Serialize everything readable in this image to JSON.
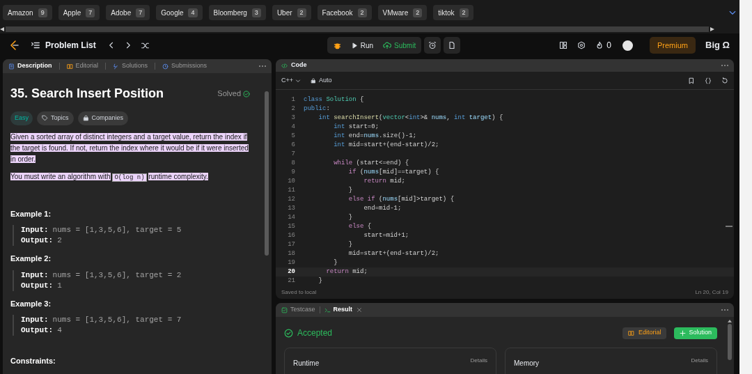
{
  "companies": [
    {
      "name": "Amazon",
      "count": "9"
    },
    {
      "name": "Apple",
      "count": "7"
    },
    {
      "name": "Adobe",
      "count": "7"
    },
    {
      "name": "Google",
      "count": "4"
    },
    {
      "name": "Bloomberg",
      "count": "3"
    },
    {
      "name": "Uber",
      "count": "2"
    },
    {
      "name": "Facebook",
      "count": "2"
    },
    {
      "name": "VMware",
      "count": "2"
    },
    {
      "name": "tiktok",
      "count": "2"
    }
  ],
  "nav": {
    "problem_list": "Problem List",
    "run": "Run",
    "submit": "Submit",
    "streak": "0",
    "premium": "Premium",
    "brand": "Big Ω"
  },
  "description": {
    "tabs": [
      {
        "label": "Description",
        "selected": true
      },
      {
        "label": "Editorial",
        "selected": false
      },
      {
        "label": "Solutions",
        "selected": false
      },
      {
        "label": "Submissions",
        "selected": false
      }
    ],
    "title": "35. Search Insert Position",
    "status": "Solved",
    "difficulty": "Easy",
    "topics": "Topics",
    "companies": "Companies",
    "paragraphs": [
      {
        "highlighted": true,
        "text": "Given a sorted array of distinct integers and a target value, return the index if the target is found. If not, return the index where it would be if it were inserted in order."
      },
      {
        "highlighted": true,
        "text": "You must write an algorithm with",
        "code": "O(log n)",
        "text_after": "runtime complexity."
      }
    ],
    "examples": [
      {
        "title": "Example 1:",
        "input_label": "Input:",
        "input": "nums = [1,3,5,6], target = 5",
        "output_label": "Output:",
        "output": "2"
      },
      {
        "title": "Example 2:",
        "input_label": "Input:",
        "input": "nums = [1,3,5,6], target = 2",
        "output_label": "Output:",
        "output": "1"
      },
      {
        "title": "Example 3:",
        "input_label": "Input:",
        "input": "nums = [1,3,5,6], target = 7",
        "output_label": "Output:",
        "output": "4"
      }
    ],
    "constraints": "Constraints:"
  },
  "code": {
    "title": "Code",
    "language": "C++",
    "mode": "Auto",
    "saved": "Saved to local",
    "cursor": "Ln 20, Col 19",
    "lines": [
      {
        "number": "1",
        "current": false,
        "tokens": [
          {
            "kind": "keyword",
            "text": "class "
          },
          {
            "kind": "type",
            "text": "Solution"
          },
          {
            "kind": "plain",
            "text": " {"
          }
        ]
      },
      {
        "number": "2",
        "current": false,
        "tokens": [
          {
            "kind": "keyword",
            "text": "public"
          },
          {
            "kind": "plain",
            "text": ":"
          }
        ]
      },
      {
        "number": "3",
        "current": false,
        "tokens": [
          {
            "kind": "keyword",
            "text": "    int "
          },
          {
            "kind": "func",
            "text": "searchInsert"
          },
          {
            "kind": "plain",
            "text": "("
          },
          {
            "kind": "type",
            "text": "vector"
          },
          {
            "kind": "plain",
            "text": "<"
          },
          {
            "kind": "keyword",
            "text": "int"
          },
          {
            "kind": "plain",
            "text": ">& "
          },
          {
            "kind": "var",
            "text": "nums"
          },
          {
            "kind": "plain",
            "text": ", "
          },
          {
            "kind": "keyword",
            "text": "int "
          },
          {
            "kind": "var",
            "text": "target"
          },
          {
            "kind": "plain",
            "text": ") {"
          }
        ]
      },
      {
        "number": "4",
        "current": false,
        "tokens": [
          {
            "kind": "keyword",
            "text": "        int"
          },
          {
            "kind": "plain",
            "text": " start=0;"
          }
        ]
      },
      {
        "number": "5",
        "current": false,
        "tokens": [
          {
            "kind": "keyword",
            "text": "        int"
          },
          {
            "kind": "plain",
            "text": " end="
          },
          {
            "kind": "var",
            "text": "nums"
          },
          {
            "kind": "plain",
            "text": ".size()-1;"
          }
        ]
      },
      {
        "number": "6",
        "current": false,
        "tokens": [
          {
            "kind": "keyword",
            "text": "        int"
          },
          {
            "kind": "plain",
            "text": " mid=start+(end-start)/2;"
          }
        ]
      },
      {
        "number": "7",
        "current": false
      },
      {
        "number": "8",
        "current": false,
        "tokens": [
          {
            "kind": "control",
            "text": "        while"
          },
          {
            "kind": "plain",
            "text": " (start<=end) {"
          }
        ]
      },
      {
        "number": "9",
        "current": false,
        "tokens": [
          {
            "kind": "control",
            "text": "            if"
          },
          {
            "kind": "plain",
            "text": " ("
          },
          {
            "kind": "var",
            "text": "nums"
          },
          {
            "kind": "plain",
            "text": "[mid]==target) {"
          }
        ]
      },
      {
        "number": "10",
        "current": false,
        "tokens": [
          {
            "kind": "control",
            "text": "                return"
          },
          {
            "kind": "plain",
            "text": " mid;"
          }
        ]
      },
      {
        "number": "11",
        "current": false,
        "tokens": [
          {
            "kind": "plain",
            "text": "            }"
          }
        ]
      },
      {
        "number": "12",
        "current": false,
        "tokens": [
          {
            "kind": "control",
            "text": "            else if"
          },
          {
            "kind": "plain",
            "text": " ("
          },
          {
            "kind": "var",
            "text": "nums"
          },
          {
            "kind": "plain",
            "text": "[mid]>target) {"
          }
        ]
      },
      {
        "number": "13",
        "current": false,
        "tokens": [
          {
            "kind": "plain",
            "text": "                end=mid-1;"
          }
        ]
      },
      {
        "number": "14",
        "current": false,
        "tokens": [
          {
            "kind": "plain",
            "text": "            }"
          }
        ]
      },
      {
        "number": "15",
        "current": false,
        "tokens": [
          {
            "kind": "control",
            "text": "            else"
          },
          {
            "kind": "plain",
            "text": " {"
          }
        ]
      },
      {
        "number": "16",
        "current": false,
        "tokens": [
          {
            "kind": "plain",
            "text": "                start=mid+1;"
          }
        ]
      },
      {
        "number": "17",
        "current": false,
        "tokens": [
          {
            "kind": "plain",
            "text": "            }"
          }
        ]
      },
      {
        "number": "18",
        "current": false,
        "tokens": [
          {
            "kind": "plain",
            "text": "            mid=start+(end-start)/2;"
          }
        ]
      },
      {
        "number": "19",
        "current": false,
        "tokens": [
          {
            "kind": "plain",
            "text": "        }"
          }
        ]
      },
      {
        "number": "20",
        "current": true,
        "tokens": [
          {
            "kind": "control",
            "text": "      return"
          },
          {
            "kind": "plain",
            "text": " mid;"
          }
        ]
      },
      {
        "number": "21",
        "current": false,
        "tokens": [
          {
            "kind": "plain",
            "text": "    }"
          }
        ]
      }
    ]
  },
  "result": {
    "tabs": [
      {
        "label": "Testcase",
        "selected": false
      },
      {
        "label": "Result",
        "selected": true
      }
    ],
    "verdict": "Accepted",
    "editorial": "Editorial",
    "solution": "Solution",
    "cards": [
      {
        "title": "Runtime",
        "link": "Details"
      },
      {
        "title": "Memory",
        "link": "Details"
      }
    ]
  }
}
